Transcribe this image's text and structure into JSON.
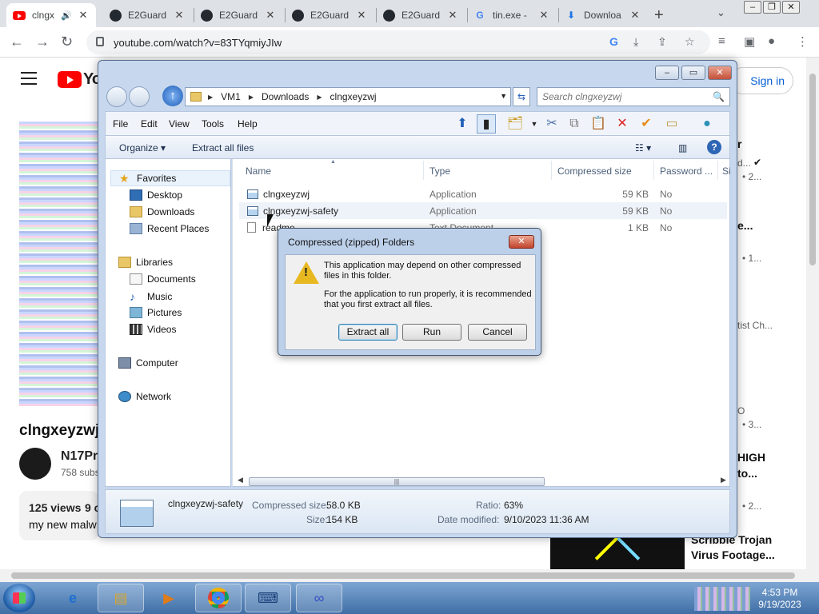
{
  "browser": {
    "tabs": [
      {
        "title": "clngx",
        "icon": "youtube-icon",
        "active": true
      },
      {
        "title": "E2Guard",
        "icon": "github-icon"
      },
      {
        "title": "E2Guard",
        "icon": "github-icon"
      },
      {
        "title": "E2Guard",
        "icon": "github-icon"
      },
      {
        "title": "E2Guard",
        "icon": "github-icon"
      },
      {
        "title": "tin.exe -",
        "icon": "google-icon"
      },
      {
        "title": "Downloa",
        "icon": "download-icon"
      }
    ],
    "url": "youtube.com/watch?v=83TYqmiyJIw"
  },
  "youtube": {
    "logo_text": "Yo",
    "sign_in": "Sign in",
    "video_title": "clngxeyzwj",
    "channel_name": "N17Pr",
    "subscribers": "758 subs",
    "views": "125 views",
    "views_extra": "9 c",
    "description_snippet": "my new malw",
    "sidebar": {
      "r1": "r",
      "r2": "d...",
      "r3": "• 2...",
      "r4": "e...",
      "r5": "• 1...",
      "r6": "tist Ch...",
      "r7": "O",
      "r8": "• 3...",
      "r9": "HIGH",
      "r10": "to...",
      "r11": "• 2...",
      "last_title_line1": "Scribble Trojan",
      "last_title_line2": "Virus Footage..."
    }
  },
  "explorer": {
    "breadcrumb": [
      "VM1",
      "Downloads",
      "clngxeyzwj"
    ],
    "search_placeholder": "Search clngxeyzwj",
    "menu": [
      "File",
      "Edit",
      "View",
      "Tools",
      "Help"
    ],
    "commands": {
      "organize": "Organize",
      "extract_all": "Extract all files"
    },
    "nav": {
      "favorites": "Favorites",
      "desktop": "Desktop",
      "downloads": "Downloads",
      "recent": "Recent Places",
      "libraries": "Libraries",
      "documents": "Documents",
      "music": "Music",
      "pictures": "Pictures",
      "videos": "Videos",
      "computer": "Computer",
      "network": "Network"
    },
    "columns": {
      "name": "Name",
      "type": "Type",
      "compressed_size": "Compressed size",
      "password": "Password ...",
      "size": "Si"
    },
    "files": [
      {
        "name": "clngxeyzwj",
        "type": "Application",
        "compressed_size": "59 KB",
        "password": "No"
      },
      {
        "name": "clngxeyzwj-safety",
        "type": "Application",
        "compressed_size": "59 KB",
        "password": "No"
      },
      {
        "name": "readme",
        "type": "Text Document",
        "compressed_size": "1 KB",
        "password": "No"
      }
    ],
    "details": {
      "file_name": "clngxeyzwj-safety",
      "compressed_size_label": "Compressed size:",
      "compressed_size": "58.0 KB",
      "size_label": "Size:",
      "size": "154 KB",
      "ratio_label": "Ratio:",
      "ratio": "63%",
      "date_label": "Date modified:",
      "date": "9/10/2023 11:36 AM"
    }
  },
  "dialog": {
    "title": "Compressed (zipped) Folders",
    "message1": "This application may depend on other compressed files in this folder.",
    "message2": "For the application to run properly, it is recommended that you first extract all files.",
    "buttons": {
      "extract": "Extract all",
      "run": "Run",
      "cancel": "Cancel"
    }
  },
  "taskbar": {
    "time": "4:53 PM",
    "date": "9/19/2023"
  }
}
